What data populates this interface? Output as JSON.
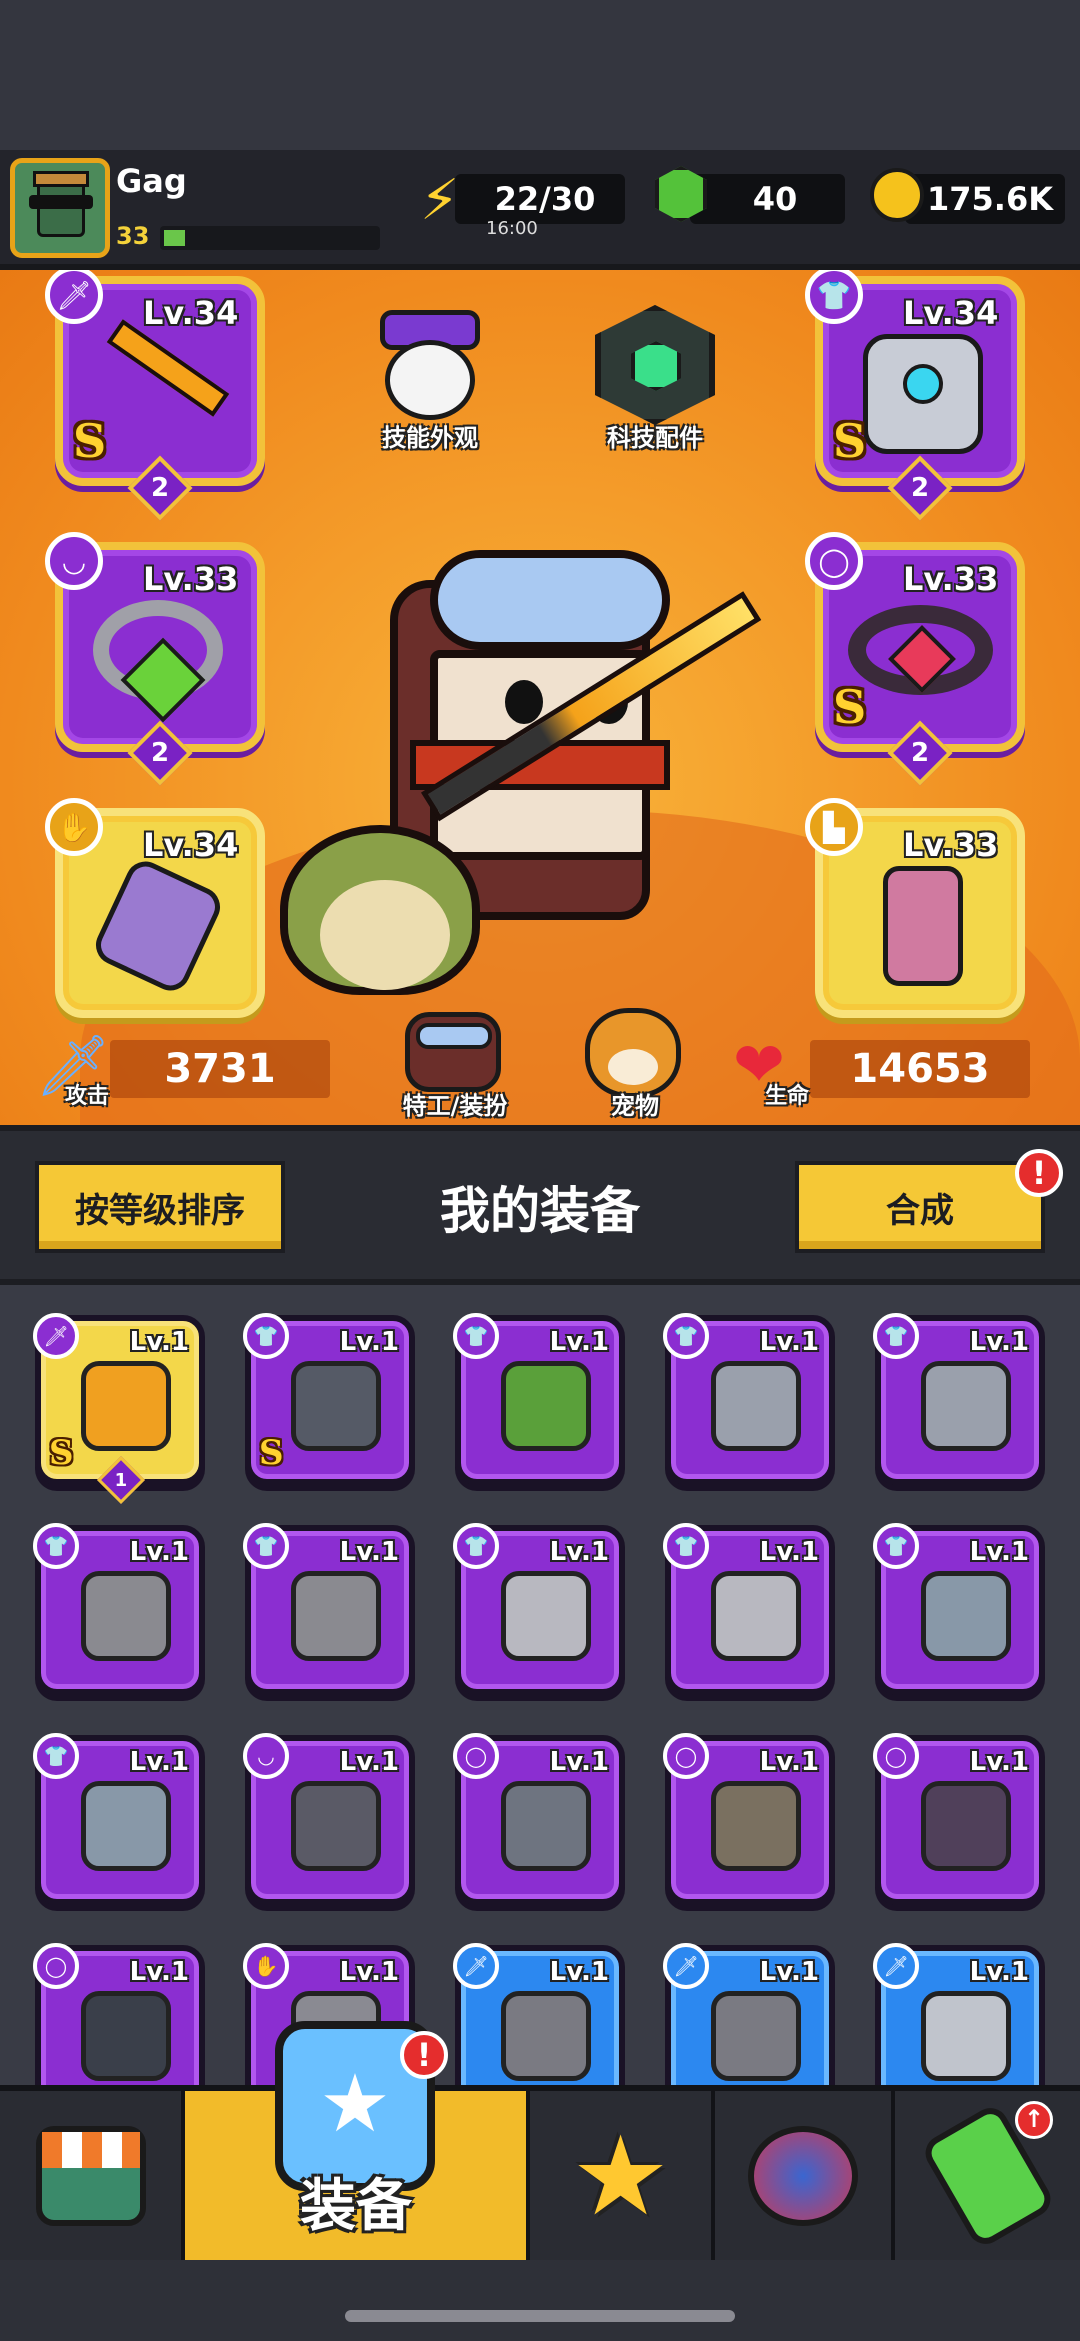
{
  "player": {
    "name": "Gag",
    "level": "33",
    "xp_fraction": 0.1
  },
  "resources": {
    "energy": {
      "value": "22/30",
      "timer": "16:00"
    },
    "gems": {
      "value": "40"
    },
    "coins": {
      "value": "175.6K"
    }
  },
  "equipped": {
    "weapon": {
      "level": "Lv.34",
      "rank": "S",
      "stars": "2",
      "icon": "sword-icon"
    },
    "armor": {
      "level": "Lv.34",
      "rank": "S",
      "stars": "2",
      "icon": "armor-icon"
    },
    "necklace": {
      "level": "Lv.33",
      "stars": "2",
      "icon": "necklace-icon"
    },
    "belt": {
      "level": "Lv.33",
      "rank": "S",
      "stars": "2",
      "icon": "belt-icon"
    },
    "gloves": {
      "level": "Lv.34",
      "icon": "glove-icon"
    },
    "boots": {
      "level": "Lv.33",
      "icon": "boot-icon"
    }
  },
  "features": {
    "skill_skin": "技能外观",
    "tech_parts": "科技配件",
    "agent_outfit": "特工/装扮",
    "pet": "宠物"
  },
  "stats": {
    "attack_label": "攻击",
    "attack_value": "3731",
    "hp_label": "生命",
    "hp_value": "14653"
  },
  "equipment_bar": {
    "sort_button": "按等级排序",
    "title": "我的装备",
    "merge_button": "合成",
    "merge_badge": "!"
  },
  "inventory": [
    {
      "level": "Lv.1",
      "rank": "S",
      "stars": "1",
      "color": "gold",
      "type": "weapon",
      "art": "#f0a020"
    },
    {
      "level": "Lv.1",
      "rank": "S",
      "color": "purple",
      "type": "armor",
      "art": "#555a66"
    },
    {
      "level": "Lv.1",
      "color": "purple",
      "type": "armor",
      "art": "#5aa03a"
    },
    {
      "level": "Lv.1",
      "color": "purple",
      "type": "armor",
      "art": "#9aa0ac"
    },
    {
      "level": "Lv.1",
      "color": "purple",
      "type": "armor",
      "art": "#9aa0ac"
    },
    {
      "level": "Lv.1",
      "color": "purple",
      "type": "armor",
      "art": "#8a8a90"
    },
    {
      "level": "Lv.1",
      "color": "purple",
      "type": "armor",
      "art": "#8a8a90"
    },
    {
      "level": "Lv.1",
      "color": "purple",
      "type": "armor",
      "art": "#b8b8c0"
    },
    {
      "level": "Lv.1",
      "color": "purple",
      "type": "armor",
      "art": "#b8b8c0"
    },
    {
      "level": "Lv.1",
      "color": "purple",
      "type": "armor",
      "art": "#8898a8"
    },
    {
      "level": "Lv.1",
      "color": "purple",
      "type": "armor",
      "art": "#8898a8"
    },
    {
      "level": "Lv.1",
      "color": "purple",
      "type": "necklace",
      "art": "#5a5a66"
    },
    {
      "level": "Lv.1",
      "color": "purple",
      "type": "belt",
      "art": "#6e7480"
    },
    {
      "level": "Lv.1",
      "color": "purple",
      "type": "belt",
      "art": "#7a7060"
    },
    {
      "level": "Lv.1",
      "color": "purple",
      "type": "belt",
      "art": "#50405a"
    },
    {
      "level": "Lv.1",
      "color": "purple",
      "type": "belt",
      "art": "#3a3f4a"
    },
    {
      "level": "Lv.1",
      "color": "purple",
      "type": "glove",
      "art": "#8a8a92"
    },
    {
      "level": "Lv.1",
      "color": "blue",
      "type": "weapon",
      "art": "#7a7a82"
    },
    {
      "level": "Lv.1",
      "color": "blue",
      "type": "weapon",
      "art": "#7a7a82"
    },
    {
      "level": "Lv.1",
      "color": "blue",
      "type": "weapon",
      "art": "#c0c4cc"
    }
  ],
  "nav": {
    "active_label": "装备",
    "equip_badge": "!"
  },
  "colors": {
    "accent": "#f5c836",
    "purple_rarity": "#8b2ed1",
    "gold_rarity": "#f3d74a",
    "blue_rarity": "#2c88f0",
    "hero_bg": "#f08a1e"
  }
}
